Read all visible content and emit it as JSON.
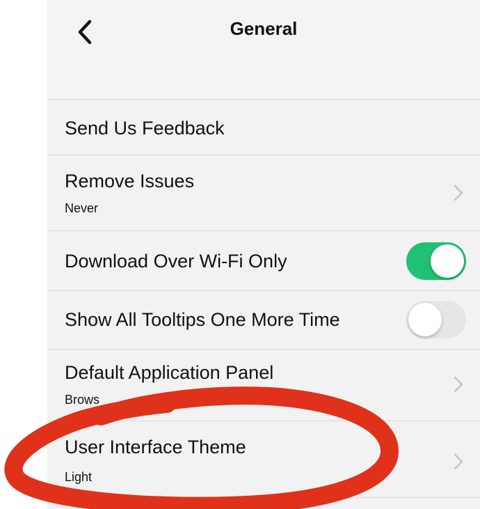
{
  "header": {
    "title": "General",
    "back_icon": "chevron-left-icon"
  },
  "settings": [
    {
      "label": "Send Us Feedback",
      "subtitle": null,
      "accessory": "none"
    },
    {
      "label": "Remove Issues",
      "subtitle": "Never",
      "accessory": "chevron"
    },
    {
      "label": "Download Over Wi-Fi Only",
      "subtitle": null,
      "accessory": "toggle",
      "on": true
    },
    {
      "label": "Show All Tooltips One More Time",
      "subtitle": null,
      "accessory": "toggle",
      "on": false
    },
    {
      "label": "Default Application Panel",
      "subtitle": "Brows",
      "accessory": "chevron"
    },
    {
      "label": "User Interface Theme",
      "subtitle": "Light",
      "accessory": "chevron"
    }
  ],
  "colors": {
    "toggle_on": "#20c174",
    "toggle_off": "#e6e6e6",
    "annotation": "#e0311a",
    "chevron": "#c4c4c4"
  }
}
